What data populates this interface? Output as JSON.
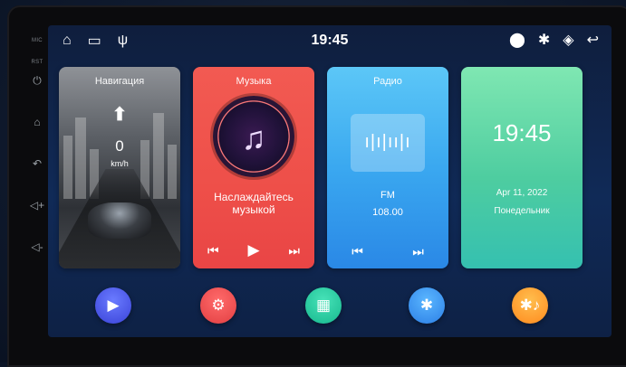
{
  "side_panel": {
    "labels": [
      "MIC",
      "RST"
    ],
    "buttons": [
      {
        "icon": "power-icon",
        "glyph": "⏻"
      },
      {
        "icon": "home-icon",
        "glyph": "⌂"
      },
      {
        "icon": "back-icon",
        "glyph": "↶"
      },
      {
        "icon": "volume-up-icon",
        "glyph": "◁+"
      },
      {
        "icon": "volume-down-icon",
        "glyph": "◁-"
      }
    ]
  },
  "statusbar": {
    "time": "19:45",
    "left_icons": [
      {
        "icon": "home-icon",
        "glyph": "⌂"
      },
      {
        "icon": "window-icon",
        "glyph": "▭"
      },
      {
        "icon": "usb-icon",
        "glyph": "ψ"
      }
    ],
    "right_icons": [
      {
        "icon": "location-icon",
        "glyph": "⬤"
      },
      {
        "icon": "bluetooth-icon",
        "glyph": "✱"
      },
      {
        "icon": "wifi-icon",
        "glyph": "◈"
      },
      {
        "icon": "return-icon",
        "glyph": "↩"
      }
    ]
  },
  "cards": {
    "navigation": {
      "title": "Навигация",
      "speed": "0",
      "unit": "km/h",
      "arrow": "⬆"
    },
    "music": {
      "title": "Музыка",
      "text_line1": "Наслаждайтесь",
      "text_line2": "музыкой",
      "controls": [
        "⏮",
        "▶",
        "⏭"
      ]
    },
    "radio": {
      "title": "Радио",
      "band": "FM",
      "frequency": "108.00",
      "wave": "ı|ı|ıı|ı",
      "controls": [
        "⏮",
        "⏭"
      ]
    },
    "clock": {
      "time": "19:45",
      "date": "Apr 11, 2022",
      "day": "Понедельник"
    }
  },
  "dock": [
    {
      "name": "play-app",
      "icon": "play-icon",
      "glyph": "▶"
    },
    {
      "name": "settings-app",
      "icon": "gear-icon",
      "glyph": "⚙"
    },
    {
      "name": "apps-app",
      "icon": "apps-grid-icon",
      "glyph": "▦"
    },
    {
      "name": "bluetooth-app",
      "icon": "bluetooth-icon",
      "glyph": "✱"
    },
    {
      "name": "bt-music-app",
      "icon": "bluetooth-music-icon",
      "glyph": "✱♪"
    }
  ],
  "colors": {
    "nav": "#5b5f65",
    "music": "#ee4f49",
    "radio": "#3aa8f0",
    "clock": "#4ecda0",
    "background": "#0f1e3d"
  }
}
